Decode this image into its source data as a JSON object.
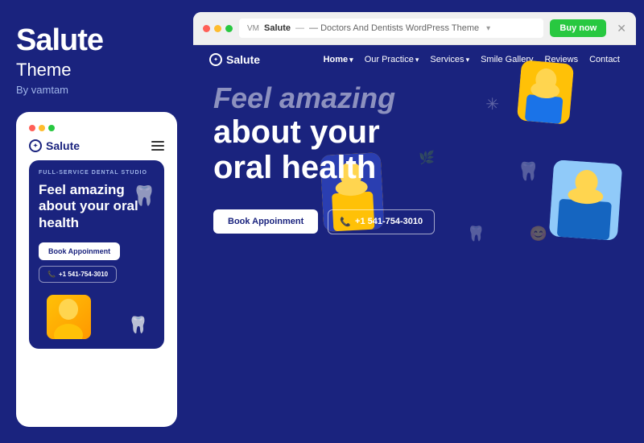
{
  "leftPanel": {
    "brandTitle": "Salute",
    "brandSubtitle": "Theme",
    "brandBy": "By vamtam"
  },
  "mobileCard": {
    "dots": [
      "red",
      "yellow",
      "green"
    ],
    "logoText": "Salute",
    "serviceLabel": "FULL-SERVICE DENTAL STUDIO",
    "headline": "Feel amazing about your oral health",
    "btnBook": "Book Appoinment",
    "btnPhone": "+1 541-754-3010"
  },
  "browser": {
    "siteName": "Salute",
    "pathLabel": "— Doctors And Dentists WordPress Theme",
    "buyLabel": "Buy now"
  },
  "websiteNav": {
    "logoText": "Salute",
    "links": [
      {
        "label": "Home",
        "active": true
      },
      {
        "label": "Our Practice",
        "active": false
      },
      {
        "label": "Services",
        "active": false
      },
      {
        "label": "Smile Gallery",
        "active": false
      },
      {
        "label": "Reviews",
        "active": false
      },
      {
        "label": "Contact",
        "active": false
      }
    ]
  },
  "hero": {
    "headlineLine1": "Feel amazing",
    "headlineLine2": "about your",
    "headlineLine3": "oral health",
    "btnBook": "Book Appoinment",
    "btnPhone": "+1 541-754-3010"
  }
}
